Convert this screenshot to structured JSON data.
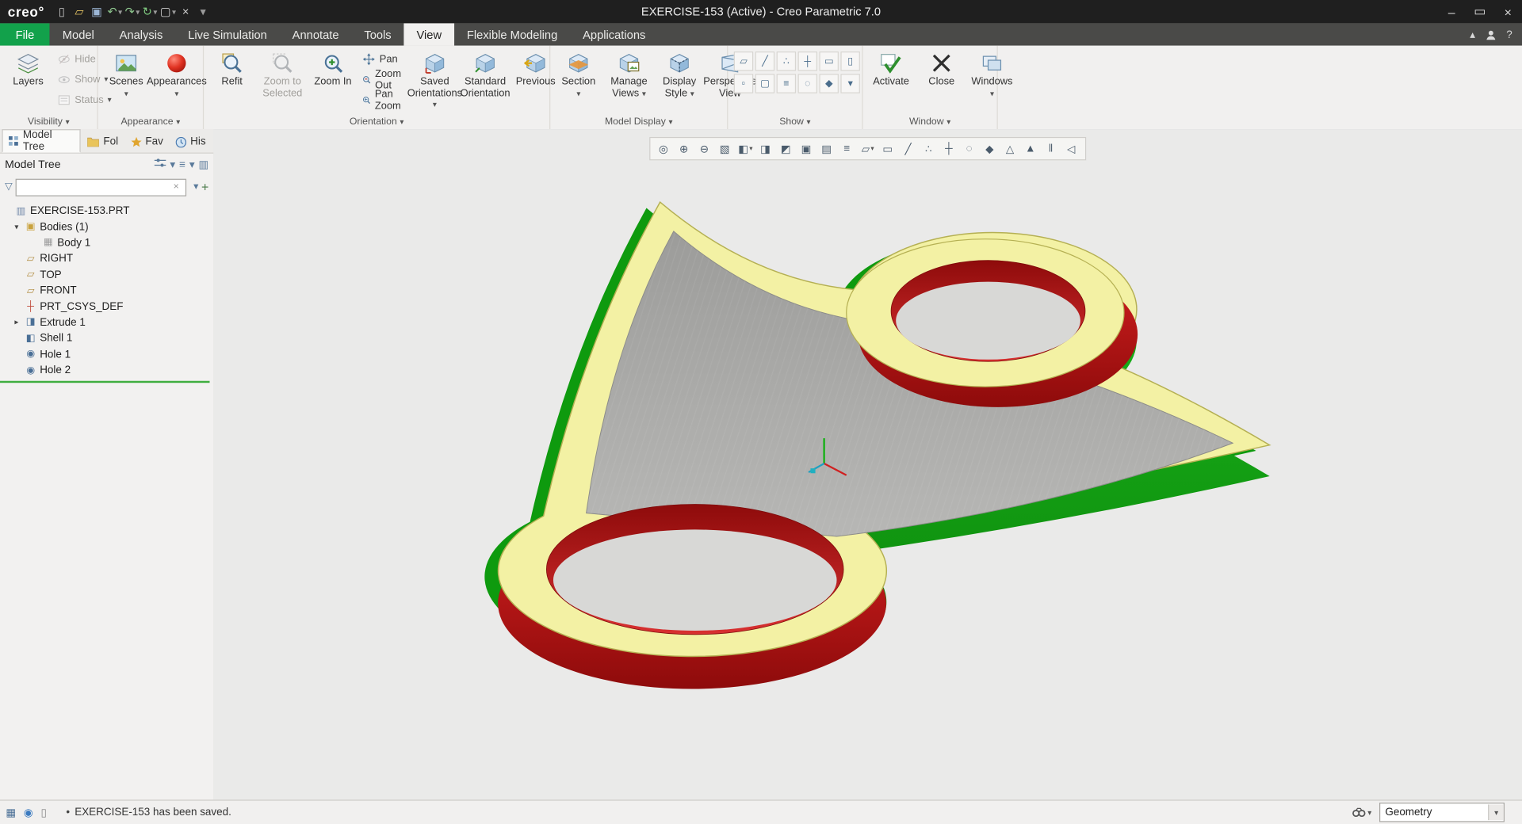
{
  "titlebar": {
    "logo": "creo°",
    "title": "EXERCISE-153 (Active) - Creo Parametric 7.0",
    "quick_items": [
      {
        "name": "new-file-icon",
        "glyph": "▯",
        "style": "color:#cfcfcf"
      },
      {
        "name": "open-file-icon",
        "glyph": "▱",
        "style": "color:#e3c363"
      },
      {
        "name": "save-icon",
        "glyph": "▣",
        "style": "color:#9db7d6"
      },
      {
        "name": "undo-icon",
        "glyph": "↶",
        "style": "color:#8fc98f",
        "caret": "▾"
      },
      {
        "name": "redo-icon",
        "glyph": "↷",
        "style": "color:#8fc98f",
        "caret": "▾"
      },
      {
        "name": "regenerate-icon",
        "glyph": "↻",
        "style": "color:#7fc97f",
        "caret": "▾"
      },
      {
        "name": "window-settings-icon",
        "glyph": "▢",
        "style": "color:#cfcfcf",
        "caret": "▾"
      },
      {
        "name": "close-window-icon",
        "glyph": "×",
        "style": "color:#cfcfcf"
      },
      {
        "name": "customize-toolbar-icon",
        "glyph": "▾",
        "style": "color:#9a9a9a"
      }
    ],
    "window_controls": [
      {
        "name": "minimize-button",
        "glyph": "–"
      },
      {
        "name": "maximize-button",
        "glyph": "▭"
      },
      {
        "name": "close-button",
        "glyph": "×"
      }
    ]
  },
  "ribbon": {
    "tabs": [
      {
        "label": "File",
        "name": "tab-file",
        "cls": "file"
      },
      {
        "label": "Model",
        "name": "tab-model"
      },
      {
        "label": "Analysis",
        "name": "tab-analysis"
      },
      {
        "label": "Live Simulation",
        "name": "tab-live-simulation"
      },
      {
        "label": "Annotate",
        "name": "tab-annotate"
      },
      {
        "label": "Tools",
        "name": "tab-tools"
      },
      {
        "label": "View",
        "name": "tab-view",
        "active": true
      },
      {
        "label": "Flexible Modeling",
        "name": "tab-flexible-modeling"
      },
      {
        "label": "Applications",
        "name": "tab-applications"
      }
    ],
    "groups": {
      "visibility": {
        "label": "Visibility",
        "layers": "Layers",
        "hide": "Hide",
        "show": "Show",
        "status": "Status"
      },
      "appearance": {
        "label": "Appearance",
        "scenes": "Scenes",
        "appearances": "Appearances"
      },
      "orientation": {
        "label": "Orientation",
        "refit": "Refit",
        "zoom_to_selected": "Zoom to Selected",
        "zoom_in": "Zoom In",
        "pan": "Pan",
        "zoom_out": "Zoom Out",
        "pan_zoom": "Pan Zoom",
        "saved_orientations": "Saved Orientations",
        "standard_orientation": "Standard Orientation",
        "previous": "Previous"
      },
      "model_display": {
        "label": "Model Display",
        "section": "Section",
        "manage_views": "Manage Views",
        "display_style": "Display Style",
        "perspective_view": "Perspective View"
      },
      "show": {
        "label": "Show",
        "row1": [
          {
            "name": "datum-plane-display-icon",
            "glyph": "▱"
          },
          {
            "name": "datum-axis-display-icon",
            "glyph": "╱"
          },
          {
            "name": "datum-point-display-icon",
            "glyph": "∴"
          },
          {
            "name": "csys-display-icon",
            "glyph": "┼"
          },
          {
            "name": "plane-tag-display-icon",
            "glyph": "▭"
          },
          {
            "name": "axis-tag-display-icon",
            "glyph": "▯"
          }
        ],
        "row2": [
          {
            "name": "point-tag-display-icon",
            "glyph": "▫"
          },
          {
            "name": "csys-tag-display-icon",
            "glyph": "▢"
          },
          {
            "name": "annotation-display-icon",
            "glyph": "≡"
          },
          {
            "name": "spin-center-icon",
            "glyph": "◌"
          },
          {
            "name": "3d-dragger-icon",
            "glyph": "◆"
          },
          {
            "name": "show-more-icon",
            "glyph": "▾"
          }
        ]
      },
      "window": {
        "label": "Window",
        "activate": "Activate",
        "close": "Close",
        "windows": "Windows"
      }
    }
  },
  "model_tree": {
    "panel_tabs": [
      {
        "label": "Model Tree",
        "name": "model-tree-tab",
        "active": true
      },
      {
        "label": "Fol",
        "name": "folder-browser-tab"
      },
      {
        "label": "Fav",
        "name": "favorites-tab"
      },
      {
        "label": "His",
        "name": "history-tab"
      }
    ],
    "header": {
      "title": "Model Tree"
    },
    "filter": {
      "value": ""
    },
    "items": [
      {
        "label": "EXERCISE-153.PRT",
        "icon": "part-icon",
        "glyph": "▥",
        "icon_style": "color:#6f86a8",
        "expander": "",
        "pad": 2
      },
      {
        "label": "Bodies (1)",
        "icon": "bodies-folder-icon",
        "glyph": "▣",
        "icon_style": "color:#c9a23d",
        "expander": "▾",
        "pad": 12
      },
      {
        "label": "Body 1",
        "icon": "body-icon",
        "glyph": "▦",
        "icon_style": "color:#9a9a9a",
        "expander": "",
        "pad": 30
      },
      {
        "label": "RIGHT",
        "icon": "datum-plane-icon",
        "glyph": "▱",
        "icon_style": "color:#b08a3e",
        "expander": "",
        "pad": 12
      },
      {
        "label": "TOP",
        "icon": "datum-plane-icon",
        "glyph": "▱",
        "icon_style": "color:#b08a3e",
        "expander": "",
        "pad": 12
      },
      {
        "label": "FRONT",
        "icon": "datum-plane-icon",
        "glyph": "▱",
        "icon_style": "color:#b08a3e",
        "expander": "",
        "pad": 12
      },
      {
        "label": "PRT_CSYS_DEF",
        "icon": "csys-icon",
        "glyph": "┼",
        "icon_style": "color:#c04a3a",
        "expander": "",
        "pad": 12
      },
      {
        "label": "Extrude 1",
        "icon": "extrude-icon",
        "glyph": "◨",
        "icon_style": "color:#4a6f96",
        "expander": "▸",
        "pad": 12
      },
      {
        "label": "Shell 1",
        "icon": "shell-icon",
        "glyph": "◧",
        "icon_style": "color:#4a6f96",
        "expander": "",
        "pad": 12
      },
      {
        "label": "Hole 1",
        "icon": "hole-icon",
        "glyph": "◉",
        "icon_style": "color:#4a6f96",
        "expander": "",
        "pad": 12
      },
      {
        "label": "Hole 2",
        "icon": "hole-icon",
        "glyph": "◉",
        "icon_style": "color:#4a6f96",
        "expander": "",
        "pad": 12
      }
    ]
  },
  "graphics_toolbar": {
    "items": [
      {
        "name": "refit-icon",
        "glyph": "◎"
      },
      {
        "name": "zoom-in-icon",
        "glyph": "⊕"
      },
      {
        "name": "zoom-out-icon",
        "glyph": "⊖"
      },
      {
        "name": "repaint-icon",
        "glyph": "▧"
      },
      {
        "name": "shading-style-icon",
        "glyph": "◧",
        "caret": "▾"
      },
      {
        "name": "transparent-display-icon",
        "glyph": "◨"
      },
      {
        "name": "enhanced-realism-icon",
        "glyph": "◩"
      },
      {
        "name": "saved-orientations-icon",
        "glyph": "▣"
      },
      {
        "name": "view-manager-icon",
        "glyph": "▤"
      },
      {
        "name": "annotation-display-icon",
        "glyph": "≡"
      },
      {
        "name": "datum-display-filters-icon",
        "glyph": "▱",
        "caret": "▾"
      },
      {
        "name": "hidden-line-icon",
        "glyph": "▭"
      },
      {
        "name": "axes-display-icon",
        "glyph": "╱"
      },
      {
        "name": "points-display-icon",
        "glyph": "∴"
      },
      {
        "name": "csys-display-icon",
        "glyph": "┼"
      },
      {
        "name": "spin-center-icon",
        "glyph": "◌"
      },
      {
        "name": "3d-dragger-icon",
        "glyph": "◆"
      },
      {
        "name": "perspective-icon",
        "glyph": "△"
      },
      {
        "name": "simulation-display-icon",
        "glyph": "▲"
      },
      {
        "name": "pause-icon",
        "glyph": "‖"
      },
      {
        "name": "exit-icon",
        "glyph": "◁"
      }
    ]
  },
  "status_bar": {
    "icons": [
      {
        "name": "status-tree-toggle-icon",
        "glyph": "▦",
        "style": "color:#4a6f96"
      },
      {
        "name": "web-browser-icon",
        "glyph": "◉",
        "style": "color:#3a7ac0"
      },
      {
        "name": "status-page-icon",
        "glyph": "▯",
        "style": "color:#888"
      }
    ],
    "bullet": "•",
    "message": "EXERCISE-153 has been saved.",
    "selector": {
      "value": "Geometry",
      "caret": "▾"
    }
  },
  "canvas": {
    "background": "#eaeae9",
    "model_colors": {
      "top_rim_yellow": "#f3f1a4",
      "outer_wall_green": "#14ac14",
      "wall_red": "#c41616",
      "floor_gray": "#a9a9a7",
      "hole_interior": "#d8d8d6"
    },
    "triad_colors": {
      "y_axis": "#0ab00a",
      "x_axis": "#d02020",
      "z_axis": "#20a0c0"
    }
  }
}
